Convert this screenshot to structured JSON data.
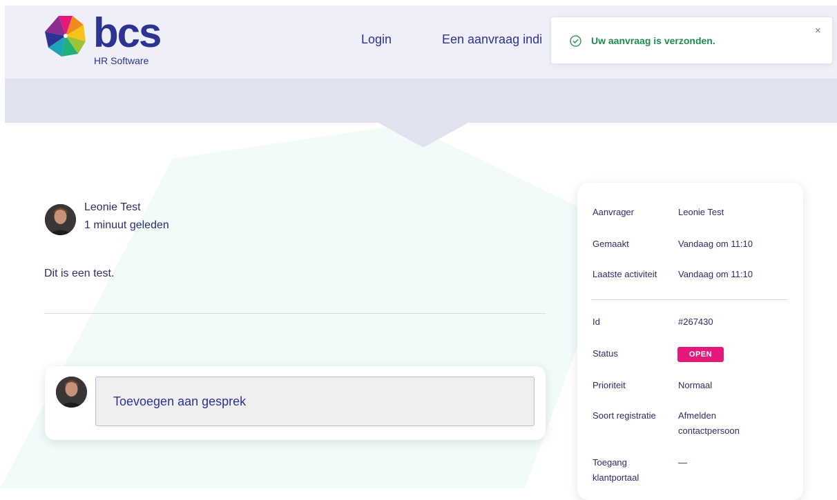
{
  "header": {
    "logo_text": "bcs",
    "logo_subtitle": "HR Software",
    "nav": {
      "login": "Login",
      "submit_request": "Een aanvraag indi"
    }
  },
  "toast": {
    "message": "Uw aanvraag is verzonden.",
    "close_label": "×",
    "icon": "check-circle-icon",
    "color": "#1f8a4f"
  },
  "conversation": {
    "author": "Leonie Test",
    "time": "1 minuut geleden",
    "message": "Dit is een test."
  },
  "reply": {
    "placeholder": "Toevoegen aan gesprek"
  },
  "details": {
    "rows": [
      {
        "label": "Aanvrager",
        "value": "Leonie Test"
      },
      {
        "label": "Gemaakt",
        "value": "Vandaag om 11:10"
      },
      {
        "label": "Laatste activiteit",
        "value": "Vandaag om 11:10"
      },
      {
        "label": "Id",
        "value": "#267430"
      },
      {
        "label": "Status",
        "value": "OPEN"
      },
      {
        "label": "Prioriteit",
        "value": "Normaal"
      },
      {
        "label": "Soort registratie",
        "value": "Afmelden contactpersoon"
      },
      {
        "label": "Toegang klantportaal",
        "value": "—"
      }
    ]
  },
  "colors": {
    "brand": "#2d3391",
    "status_open": "#e5197c",
    "header_bg": "#eeeff8",
    "subbar_bg": "#e1e2f0"
  }
}
